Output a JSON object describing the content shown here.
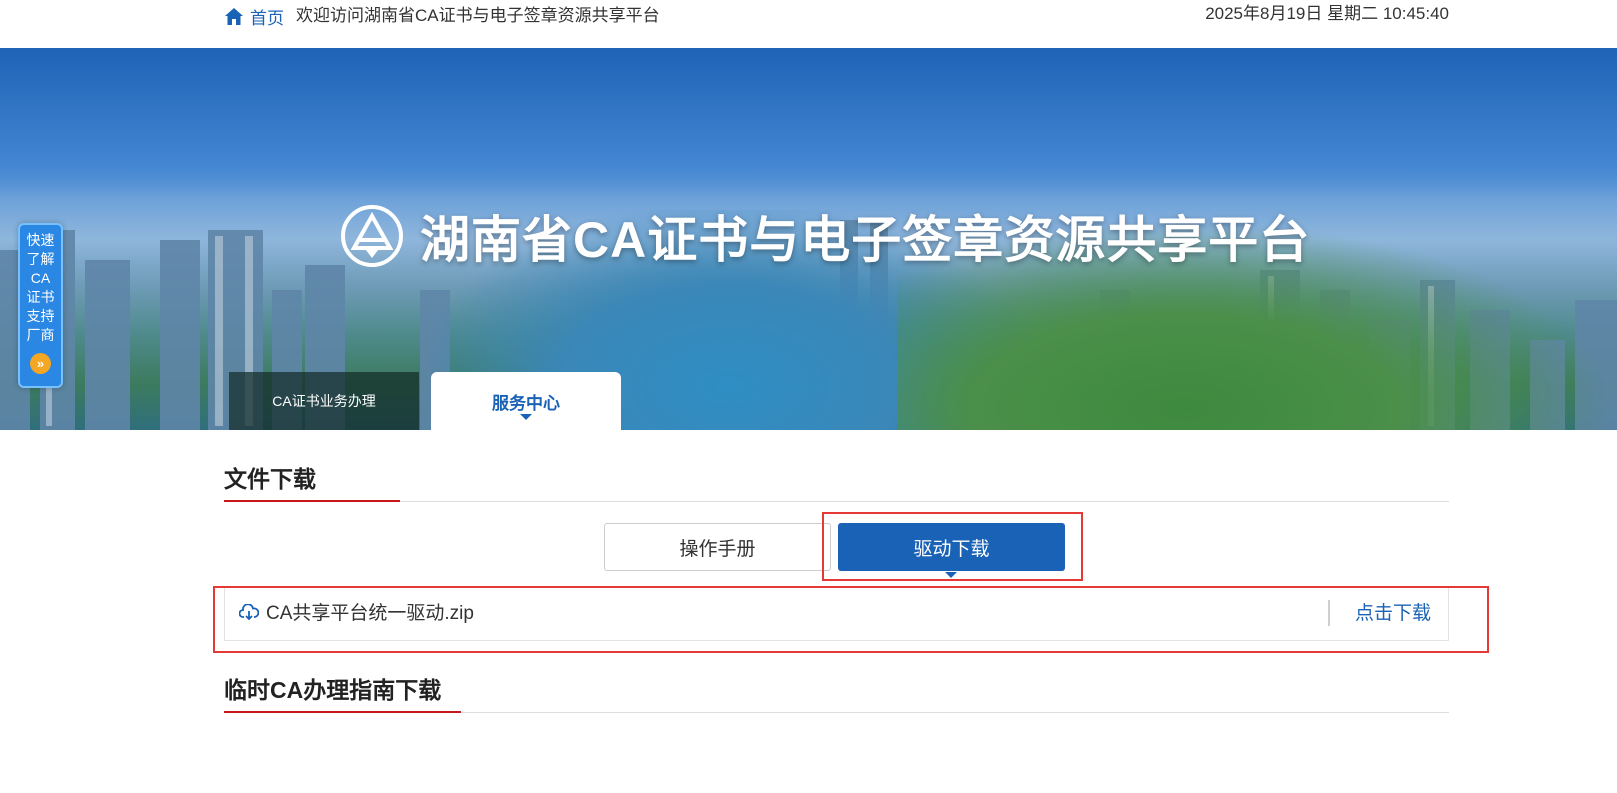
{
  "topbar": {
    "home_label": "首页",
    "welcome_text": "欢迎访问湖南省CA证书与电子签章资源共享平台",
    "datetime": "2025年8月19日 星期二 10:45:40"
  },
  "banner": {
    "title": "湖南省CA证书与电子签章资源共享平台"
  },
  "nav": {
    "tabs": [
      {
        "label": "CA证书业务办理",
        "active": false
      },
      {
        "label": "服务中心",
        "active": true
      }
    ]
  },
  "side_float": {
    "lines": [
      "快速",
      "了解",
      "CA",
      "证书",
      "支持",
      "厂商"
    ],
    "arrow": "»"
  },
  "sections": {
    "file_download": {
      "title": "文件下载"
    },
    "temp_ca_guide": {
      "title": "临时CA办理指南下载"
    }
  },
  "subtabs": {
    "manual_label": "操作手册",
    "driver_label": "驱动下载",
    "active": "驱动下载"
  },
  "file_list": [
    {
      "name": "CA共享平台统一驱动.zip",
      "action_label": "点击下载"
    }
  ],
  "colors": {
    "primary": "#1a62b5",
    "accent_red": "#c8161d",
    "highlight_box": "#e53935",
    "float_bg": "#2a87e3"
  }
}
